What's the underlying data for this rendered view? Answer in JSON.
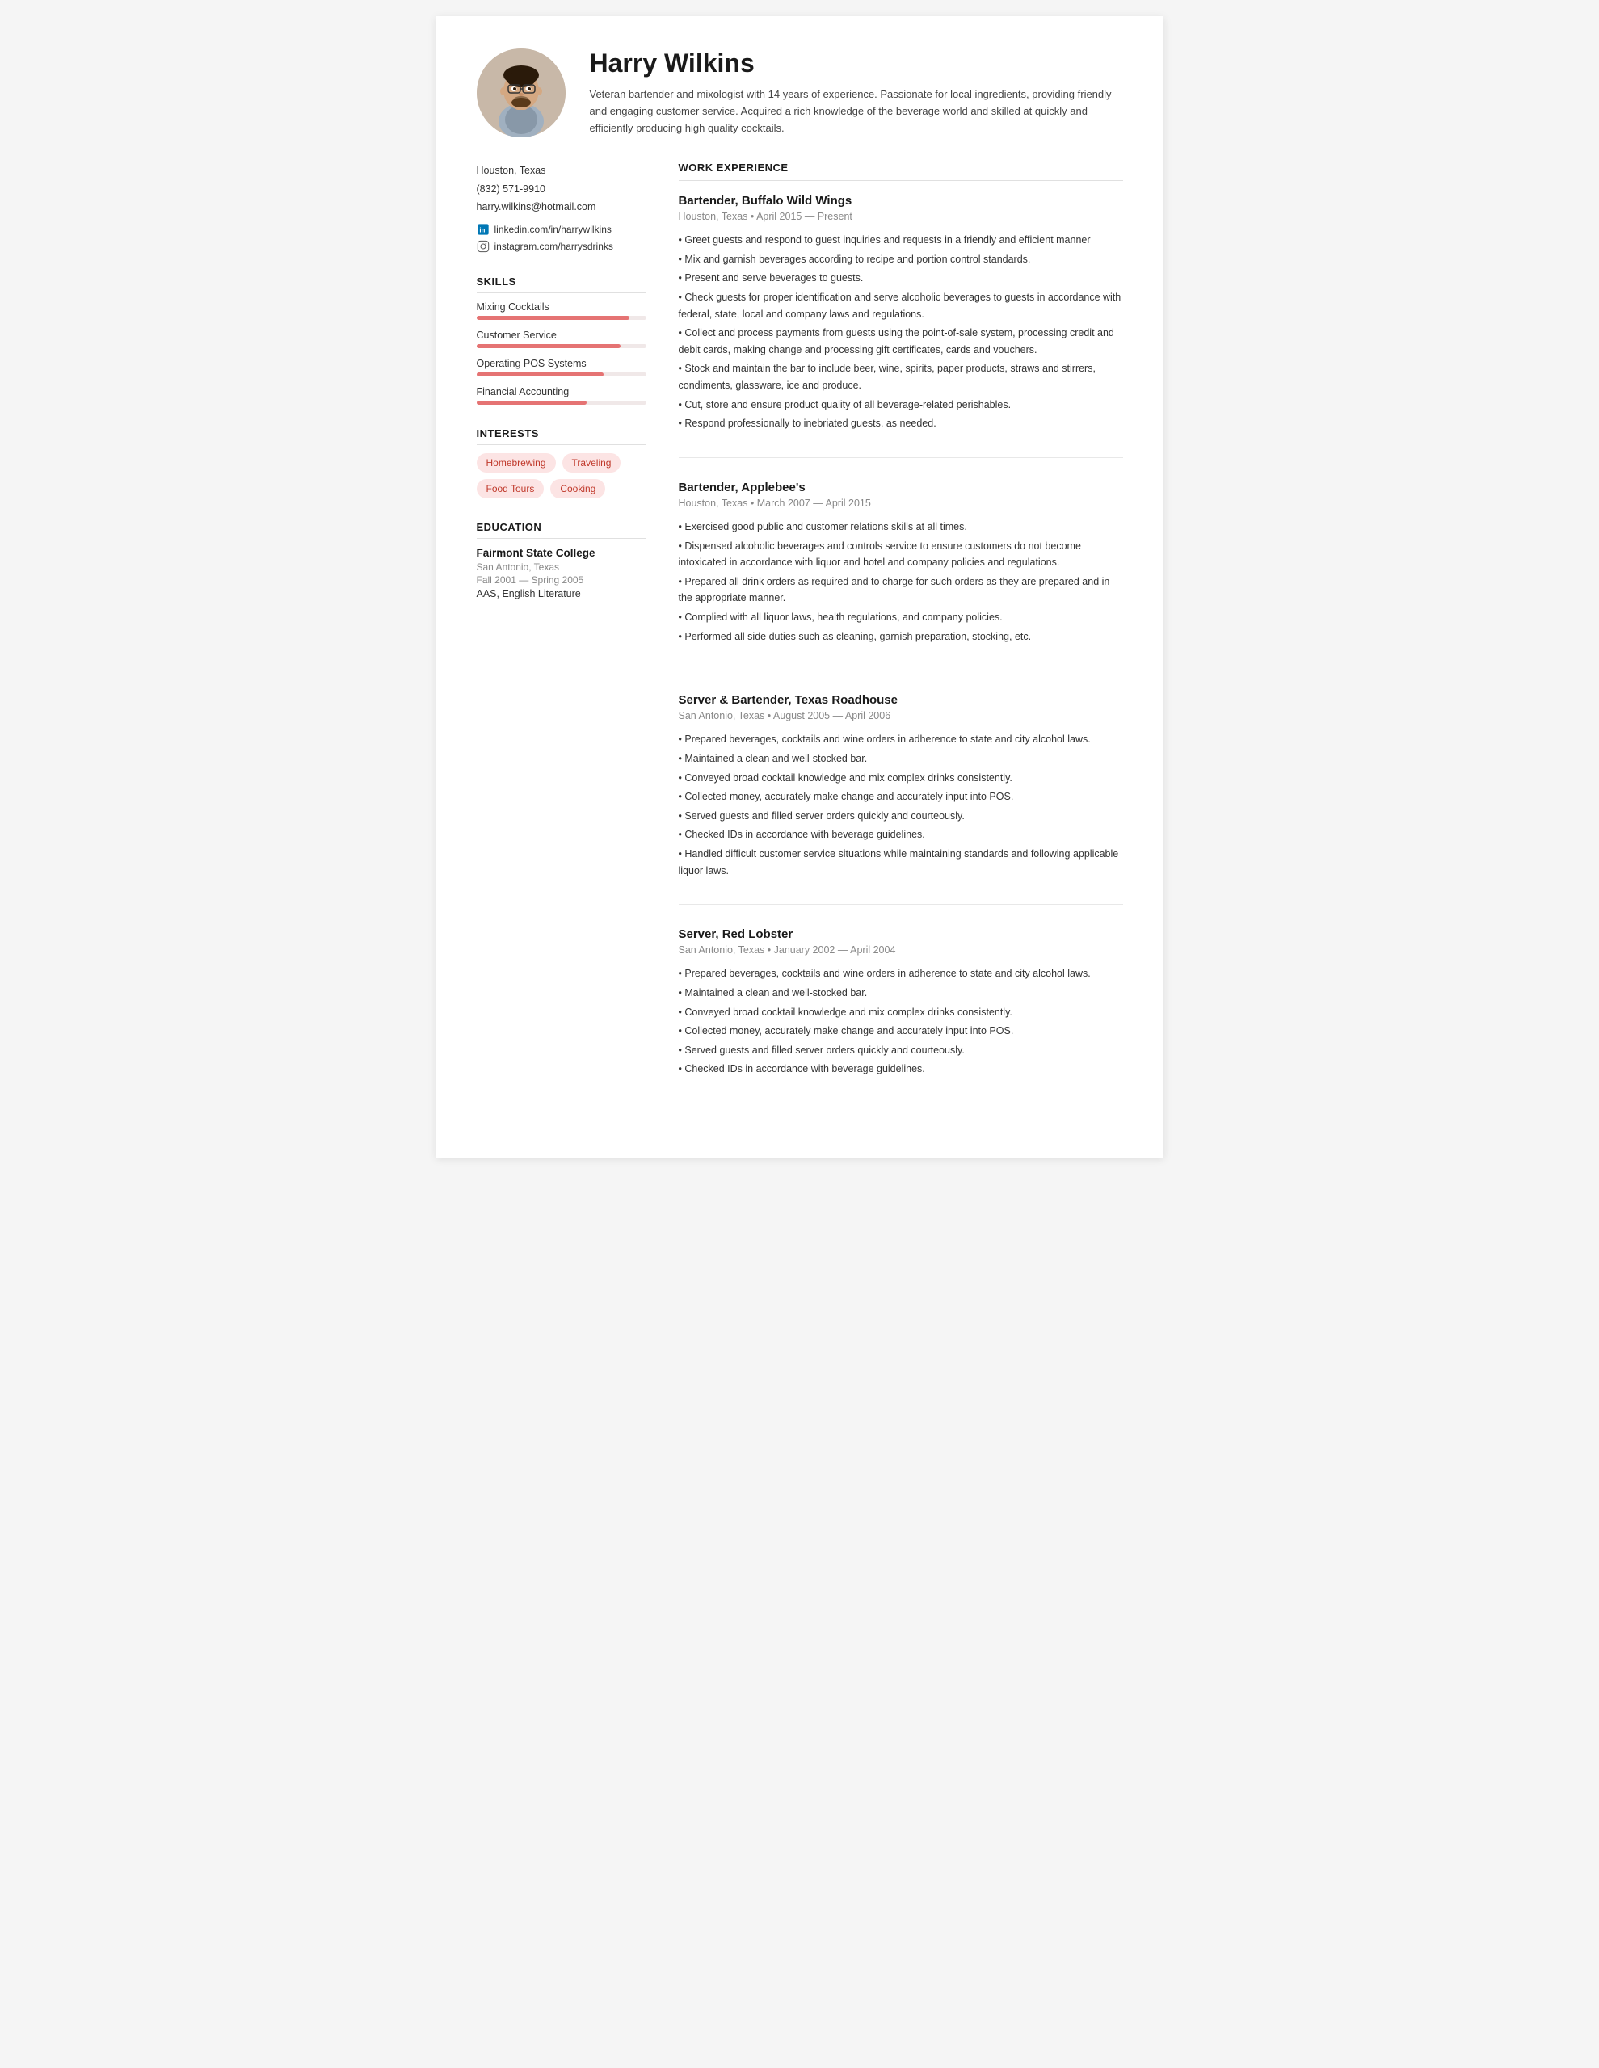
{
  "header": {
    "name": "Harry Wilkins",
    "summary": "Veteran bartender and mixologist with 14 years of experience. Passionate for local ingredients, providing friendly and engaging customer service. Acquired a rich knowledge of the beverage world and skilled at quickly and efficiently producing high quality cocktails."
  },
  "contact": {
    "location": "Houston, Texas",
    "phone": "(832) 571-9910",
    "email": "harry.wilkins@hotmail.com",
    "linkedin": "linkedin.com/in/harrywilkins",
    "instagram": "instagram.com/harrysdrinks"
  },
  "skills_title": "SKILLS",
  "skills": [
    {
      "label": "Mixing Cocktails",
      "percent": 90
    },
    {
      "label": "Customer Service",
      "percent": 85
    },
    {
      "label": "Operating POS Systems",
      "percent": 75
    },
    {
      "label": "Financial Accounting",
      "percent": 65
    }
  ],
  "interests_title": "INTERESTS",
  "interests": [
    "Homebrewing",
    "Traveling",
    "Food Tours",
    "Cooking"
  ],
  "education_title": "EDUCATION",
  "education": {
    "school": "Fairmont State College",
    "location": "San Antonio, Texas",
    "dates": "Fall 2001 — Spring 2005",
    "degree": "AAS, English Literature"
  },
  "work_title": "WORK EXPERIENCE",
  "jobs": [
    {
      "title": "Bartender, Buffalo Wild Wings",
      "meta": "Houston, Texas • April 2015 — Present",
      "bullets": [
        "Greet guests and respond to guest inquiries and requests in a friendly and efficient manner",
        "Mix and garnish beverages according to recipe and portion control standards.",
        "Present and serve beverages to guests.",
        "Check guests for proper identification and serve alcoholic beverages to guests in accordance with federal, state, local and company laws and regulations.",
        "Collect and process payments from guests using the point-of-sale system, processing credit and debit cards, making change and processing gift certificates, cards and vouchers.",
        "Stock and maintain the bar to include beer, wine, spirits, paper products, straws and stirrers, condiments, glassware, ice and produce.",
        "Cut, store and ensure product quality of all beverage-related perishables.",
        "Respond professionally to inebriated guests, as needed."
      ]
    },
    {
      "title": "Bartender, Applebee's",
      "meta": "Houston, Texas • March 2007 — April 2015",
      "bullets": [
        "Exercised good public and customer relations skills at all times.",
        "Dispensed alcoholic beverages and controls service to ensure customers do not become intoxicated in accordance with liquor and hotel and company policies and regulations.",
        "Prepared all drink orders as required and to charge for such orders as they are prepared and in the appropriate manner.",
        "Complied with all liquor laws, health regulations, and company policies.",
        "Performed all side duties such as cleaning, garnish preparation, stocking, etc."
      ]
    },
    {
      "title": "Server & Bartender, Texas Roadhouse",
      "meta": "San Antonio, Texas • August 2005 — April 2006",
      "bullets": [
        "Prepared beverages, cocktails and wine orders in adherence to state and city alcohol laws.",
        "Maintained a clean and well-stocked bar.",
        "Conveyed broad cocktail knowledge and mix complex drinks consistently.",
        "Collected money, accurately make change and accurately input into POS.",
        "Served guests and filled server orders quickly and courteously.",
        "Checked IDs in accordance with beverage guidelines.",
        "Handled difficult customer service situations while maintaining standards and following applicable liquor laws."
      ]
    },
    {
      "title": "Server, Red Lobster",
      "meta": "San Antonio, Texas • January 2002 — April 2004",
      "bullets": [
        "Prepared beverages, cocktails and wine orders in adherence to state and city alcohol laws.",
        "Maintained a clean and well-stocked bar.",
        "Conveyed broad cocktail knowledge and mix complex drinks consistently.",
        "Collected money, accurately make change and accurately input into POS.",
        "Served guests and filled server orders quickly and courteously.",
        "Checked IDs in accordance with beverage guidelines."
      ]
    }
  ]
}
